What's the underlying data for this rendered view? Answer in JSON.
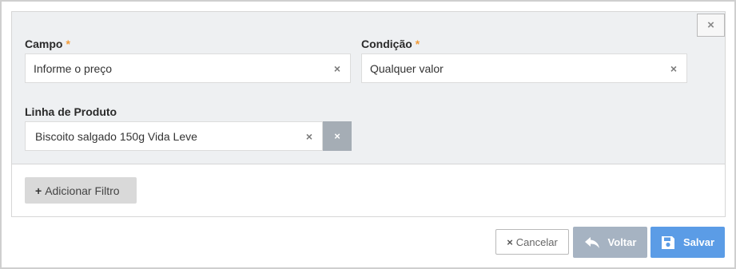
{
  "form": {
    "close_symbol": "×",
    "campo": {
      "label": "Campo",
      "required_marker": "*",
      "value": "Informe o preço",
      "clear_symbol": "×"
    },
    "condicao": {
      "label": "Condição",
      "required_marker": "*",
      "value": "Qualquer valor",
      "clear_symbol": "×"
    },
    "linha_produto": {
      "label": "Linha de Produto",
      "value": "Biscoito salgado 150g Vida Leve",
      "clear_symbol": "×",
      "remove_symbol": "×"
    },
    "add_filter": {
      "icon": "plus-icon",
      "icon_symbol": "+",
      "label": "Adicionar Filtro"
    }
  },
  "footer": {
    "cancel": {
      "icon": "close-icon",
      "icon_symbol": "×",
      "label": "Cancelar"
    },
    "back": {
      "icon": "reply-arrow-icon",
      "label": "Voltar"
    },
    "save": {
      "icon": "floppy-disk-icon",
      "label": "Salvar"
    }
  },
  "colors": {
    "required": "#f29b38",
    "panel_bg": "#eef0f2",
    "save": "#5b9ce6",
    "back": "#a6b3c2",
    "remove": "#a5adb5"
  }
}
